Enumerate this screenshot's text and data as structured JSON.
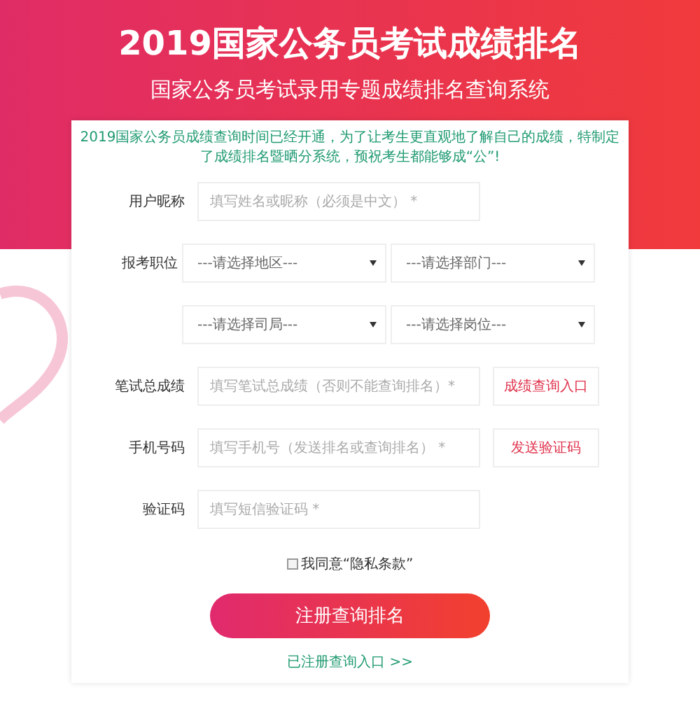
{
  "header": {
    "title": "2019国家公务员考试成绩排名",
    "subtitle": "国家公务员考试录用专题成绩排名查询系统"
  },
  "notice": "2019国家公务员成绩查询时间已经开通，为了让考生更直观地了解自己的成绩，特制定了成绩排名暨晒分系统，预祝考生都能够成“公”!",
  "fields": [
    {
      "kind": "text",
      "label": "用户昵称",
      "placeholder": "填写姓名或昵称（必须是中文） *"
    },
    {
      "kind": "selects",
      "label": "报考职位",
      "selects": [
        "---请选择地区---",
        "---请选择部门---"
      ]
    },
    {
      "kind": "selects",
      "selects": [
        "---请选择司局---",
        "---请选择岗位---"
      ]
    },
    {
      "kind": "text",
      "label": "笔试总成绩",
      "placeholder": "填写笔试总成绩（否则不能查询排名）*",
      "action": "成绩查询入口"
    },
    {
      "kind": "text",
      "label": "手机号码",
      "placeholder": "填写手机号（发送排名或查询排名） *",
      "action": "发送验证码"
    },
    {
      "kind": "text",
      "label": "验证码",
      "placeholder": "填写短信验证码 *"
    }
  ],
  "agreement": {
    "label": "我同意“隐私条款”",
    "checked": false
  },
  "submit": "注册查询排名",
  "login_link": "已注册查询入口 >>"
}
